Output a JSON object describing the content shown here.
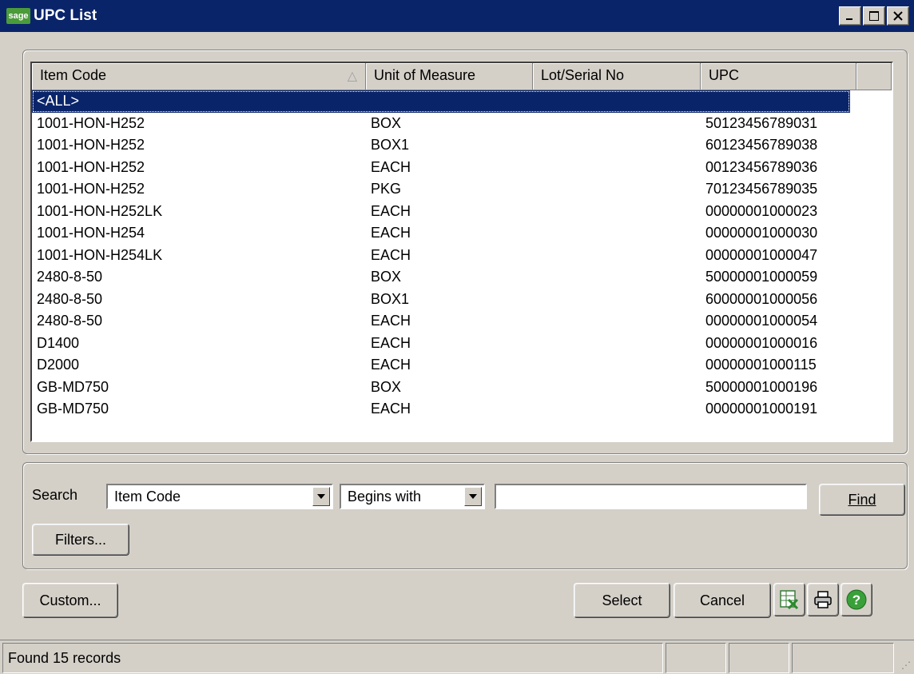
{
  "window": {
    "logo_text": "sage",
    "title": "UPC List"
  },
  "grid": {
    "columns": [
      "Item Code",
      "Unit of Measure",
      "Lot/Serial No",
      "UPC"
    ],
    "sort_indicator": "△",
    "rows": [
      [
        "<ALL>",
        "",
        "",
        ""
      ],
      [
        "1001-HON-H252",
        "BOX",
        "",
        "50123456789031"
      ],
      [
        "1001-HON-H252",
        "BOX1",
        "",
        "60123456789038"
      ],
      [
        "1001-HON-H252",
        "EACH",
        "",
        "00123456789036"
      ],
      [
        "1001-HON-H252",
        "PKG",
        "",
        "70123456789035"
      ],
      [
        "1001-HON-H252LK",
        "EACH",
        "",
        "00000001000023"
      ],
      [
        "1001-HON-H254",
        "EACH",
        "",
        "00000001000030"
      ],
      [
        "1001-HON-H254LK",
        "EACH",
        "",
        "00000001000047"
      ],
      [
        "2480-8-50",
        "BOX",
        "",
        "50000001000059"
      ],
      [
        "2480-8-50",
        "BOX1",
        "",
        "60000001000056"
      ],
      [
        "2480-8-50",
        "EACH",
        "",
        "00000001000054"
      ],
      [
        "D1400",
        "EACH",
        "",
        "00000001000016"
      ],
      [
        "D2000",
        "EACH",
        "",
        "00000001000115"
      ],
      [
        "GB-MD750",
        "BOX",
        "",
        "50000001000196"
      ],
      [
        "GB-MD750",
        "EACH",
        "",
        "00000001000191"
      ]
    ]
  },
  "search": {
    "label": "Search",
    "field": "Item Code",
    "operator": "Begins with",
    "value": "",
    "find_label": "Find",
    "filters_label": "Filters..."
  },
  "buttons": {
    "custom": "Custom...",
    "select": "Select",
    "cancel": "Cancel"
  },
  "status": {
    "text": "Found 15 records"
  },
  "colors": {
    "title_bar": "#0a246a",
    "selection": "#0a246a",
    "dialog": "#d4d0c8"
  }
}
